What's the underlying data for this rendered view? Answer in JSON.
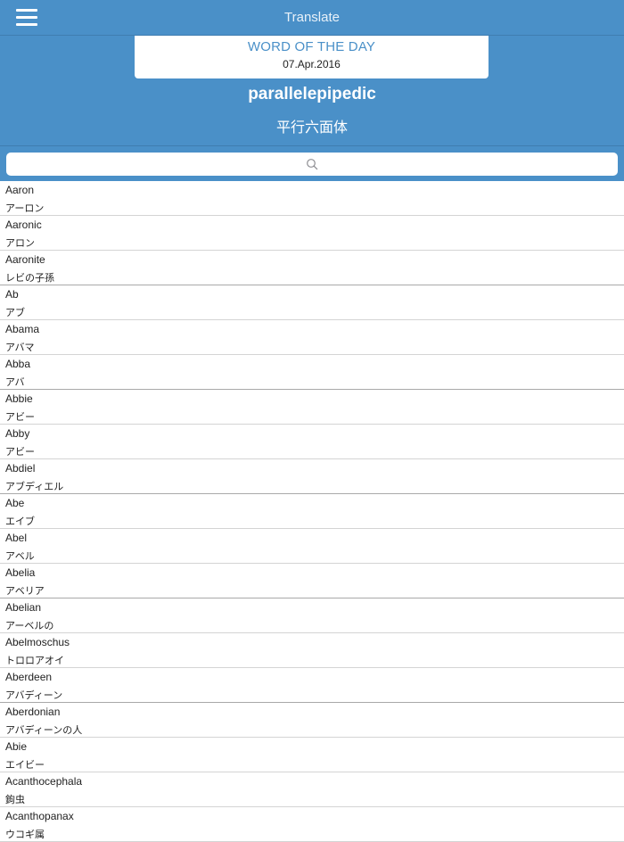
{
  "header": {
    "title": "Translate",
    "menu_icon": "hamburger-menu-icon"
  },
  "word_of_the_day": {
    "label": "WORD OF THE DAY",
    "date": "07.Apr.2016",
    "word": "parallelepipedic",
    "translation": "平行六面体"
  },
  "search": {
    "placeholder": "",
    "icon": "search-icon"
  },
  "colors": {
    "primary": "#4a90c8",
    "divider": "#d4d4d4",
    "text": "#222222"
  },
  "entries": [
    {
      "word": "Aaron",
      "meaning": "アーロン"
    },
    {
      "word": "Aaronic",
      "meaning": "アロン"
    },
    {
      "word": "Aaronite",
      "meaning": "レビの子孫"
    },
    {
      "word": "Ab",
      "meaning": "アブ"
    },
    {
      "word": "Abama",
      "meaning": "アバマ"
    },
    {
      "word": "Abba",
      "meaning": "アバ"
    },
    {
      "word": "Abbie",
      "meaning": "アビー"
    },
    {
      "word": "Abby",
      "meaning": "アビー"
    },
    {
      "word": "Abdiel",
      "meaning": "アブディエル"
    },
    {
      "word": "Abe",
      "meaning": "エイブ"
    },
    {
      "word": "Abel",
      "meaning": "アベル"
    },
    {
      "word": "Abelia",
      "meaning": "アベリア"
    },
    {
      "word": "Abelian",
      "meaning": "アーベルの"
    },
    {
      "word": "Abelmoschus",
      "meaning": "トロロアオイ"
    },
    {
      "word": "Aberdeen",
      "meaning": "アバディーン"
    },
    {
      "word": "Aberdonian",
      "meaning": "アバディーンの人"
    },
    {
      "word": "Abie",
      "meaning": "エイビー"
    },
    {
      "word": "Acanthocephala",
      "meaning": "鉤虫"
    },
    {
      "word": "Acanthopanax",
      "meaning": "ウコギ属"
    }
  ]
}
